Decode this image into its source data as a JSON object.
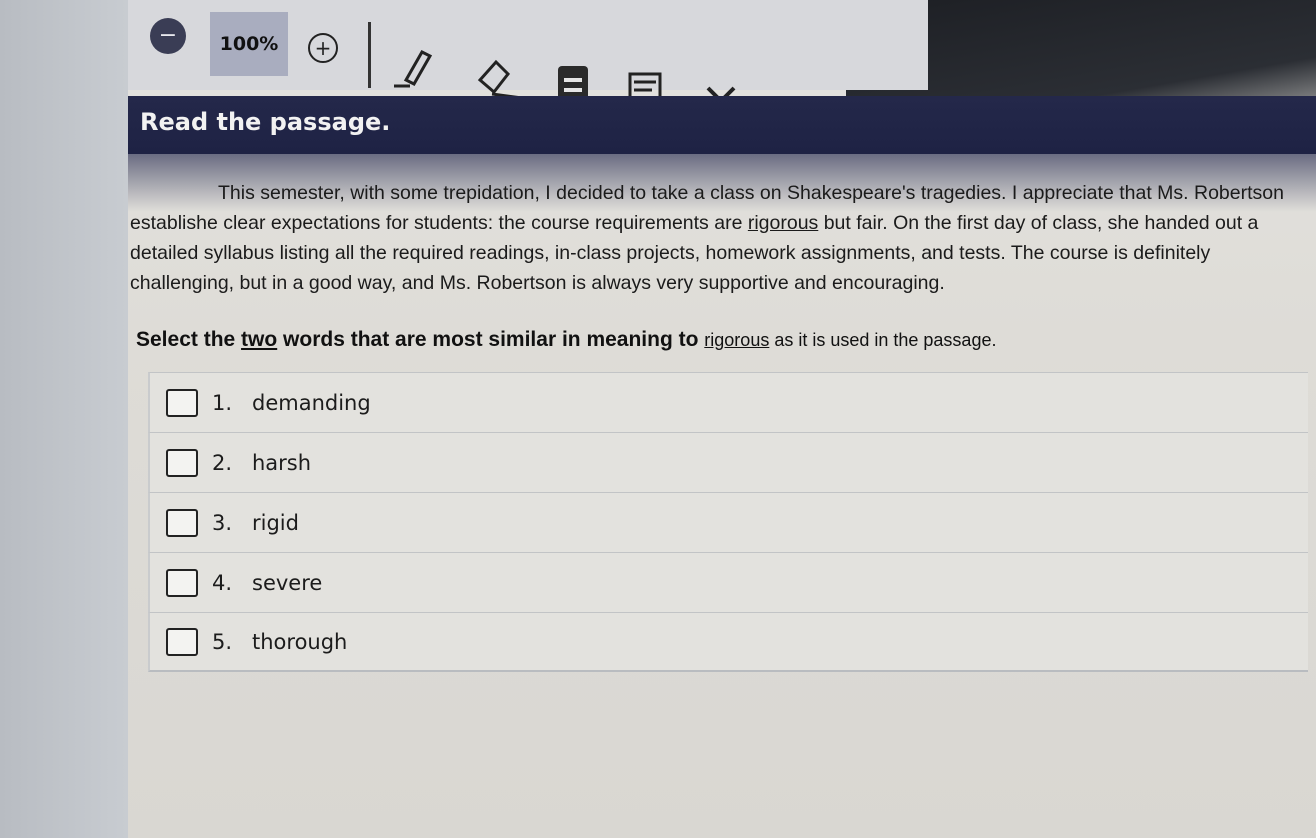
{
  "toolbar": {
    "zoom_out_icon": "minus-circle-icon",
    "zoom_level": "100%",
    "zoom_in_symbol": "+",
    "tools": [
      "pen-icon",
      "eraser-icon",
      "note-icon",
      "reference-icon",
      "cross-out-icon"
    ]
  },
  "header": {
    "title": "Read the passage."
  },
  "passage": {
    "before": "This semester, with some trepidation, I decided to take a class on Shakespeare's tragedies. I appreciate that Ms. Robertson establishe clear expectations for students: the course requirements are ",
    "keyword": "rigorous",
    "after": " but fair. On the first day of class, she handed out a detailed syllabus listing all the required readings, in-class projects, homework assignments, and tests. The course is definitely challenging, but in a good way, and Ms. Robertson is always very supportive and encouraging."
  },
  "question": {
    "lead": "Select the ",
    "emphasis": "two",
    "middle": " words that are most similar in meaning to ",
    "keyword": "rigorous",
    "tail": " as it is used in the passage."
  },
  "options": [
    {
      "num": "1.",
      "label": "demanding"
    },
    {
      "num": "2.",
      "label": "harsh"
    },
    {
      "num": "3.",
      "label": "rigid"
    },
    {
      "num": "4.",
      "label": "severe"
    },
    {
      "num": "5.",
      "label": "thorough"
    }
  ],
  "colors": {
    "header_bg": "#24284a",
    "toolbar_bg": "#d7d8dc",
    "zoom_box": "#a9adbf",
    "page_bg": "#e3e2de"
  }
}
